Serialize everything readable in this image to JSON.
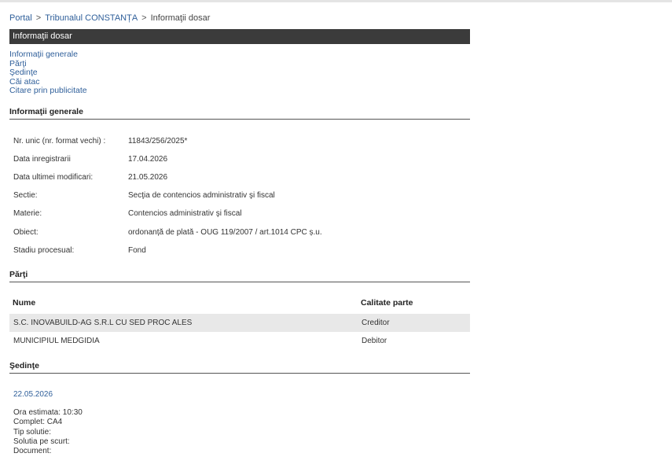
{
  "breadcrumb": {
    "portal": "Portal",
    "separator": ">",
    "court": "Tribunalul CONSTANȚA",
    "current": "Informaţii dosar"
  },
  "title_bar": "Informaţii dosar",
  "quick_links": [
    "Informaţii generale",
    "Părţi",
    "Şedinţe",
    "Căi atac",
    "Citare prin publicitate"
  ],
  "general": {
    "heading": "Informaţii generale",
    "rows": [
      {
        "label": "Nr. unic (nr. format vechi) :",
        "value": "11843/256/2025*"
      },
      {
        "label": "Data inregistrarii",
        "value": "17.04.2026"
      },
      {
        "label": "Data ultimei modificari:",
        "value": "21.05.2026"
      },
      {
        "label": "Sectie:",
        "value": "Secţia de contencios administrativ şi fiscal"
      },
      {
        "label": "Materie:",
        "value": "Contencios administrativ şi fiscal"
      },
      {
        "label": "Obiect:",
        "value": "ordonanță de plată - OUG 119/2007 / art.1014 CPC ș.u."
      },
      {
        "label": "Stadiu procesual:",
        "value": "Fond"
      }
    ]
  },
  "parti": {
    "heading": "Părţi",
    "columns": [
      "Nume",
      "Calitate parte"
    ],
    "rows": [
      {
        "name": "S.C. INOVABUILD-AG S.R.L CU SED PROC ALES",
        "role": "Creditor"
      },
      {
        "name": "MUNICIPIUL MEDGIDIA",
        "role": "Debitor"
      }
    ]
  },
  "sedinte": {
    "heading": "Şedinţe",
    "date": "22.05.2026",
    "ora": "Ora estimata: 10:30",
    "complet": "Complet: CA4",
    "tip_solutie": "Tip solutie:",
    "solutia_pe_scurt": "Solutia pe scurt:",
    "document": "Document:"
  }
}
